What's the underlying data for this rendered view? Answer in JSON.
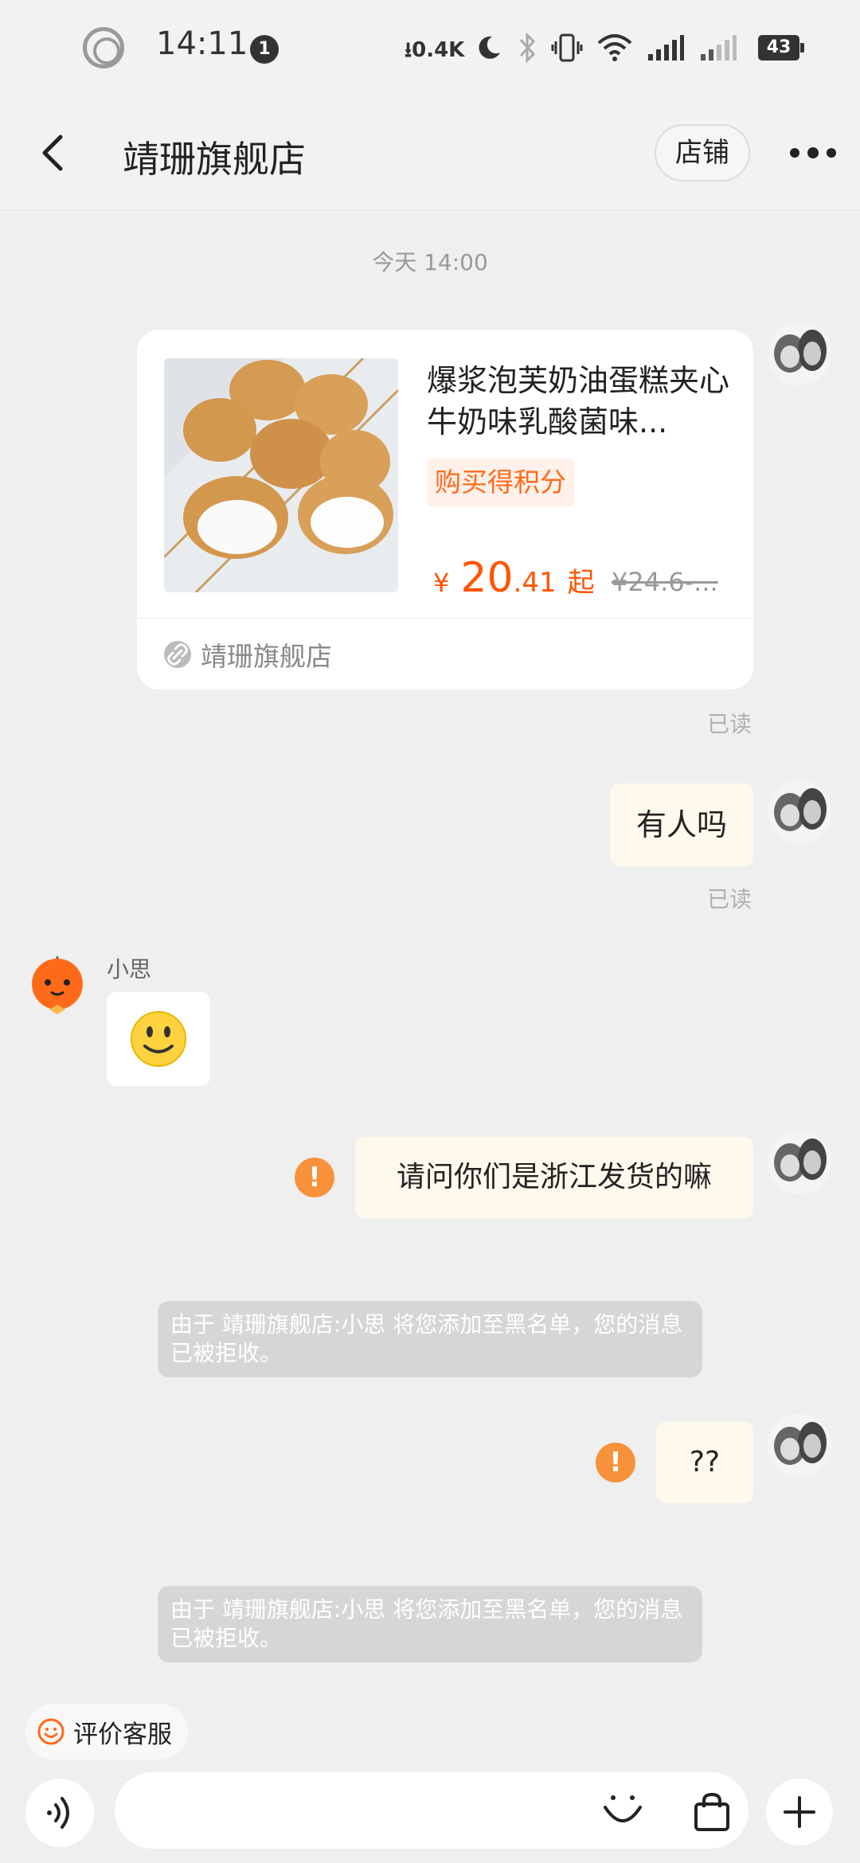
{
  "status_bar": {
    "time": "14:11",
    "notification_count": "1",
    "net_speed": "0.4K",
    "battery": "43"
  },
  "header": {
    "title": "靖珊旗舰店",
    "shop_button": "店铺"
  },
  "chat": {
    "timestamp": "今天 14:00",
    "product_card": {
      "name": "爆浆泡芙奶油蛋糕夹心牛奶味乳酸菌味...",
      "points_tag": "购买得积分",
      "currency": "¥",
      "price_int": "20",
      "price_dec": ".41",
      "price_suffix": "起",
      "old_price": "¥24.6-...",
      "shop_name": "靖珊旗舰店"
    },
    "read_1": "已读",
    "msg_1": "有人吗",
    "read_2": "已读",
    "bot_name": "小思",
    "msg_2": "请问你们是浙江发货的嘛",
    "error_mark": "!",
    "notice_1": "由于 靖珊旗舰店:小思 将您添加至黑名单，您的消息已被拒收。",
    "msg_3": "??",
    "notice_2": "由于 靖珊旗舰店:小思 将您添加至黑名单，您的消息已被拒收。"
  },
  "bottom": {
    "rate_label": "评价客服"
  },
  "colors": {
    "accent": "#ff5500",
    "error": "#f7923a",
    "outgoing_bubble": "#fff8ec"
  }
}
